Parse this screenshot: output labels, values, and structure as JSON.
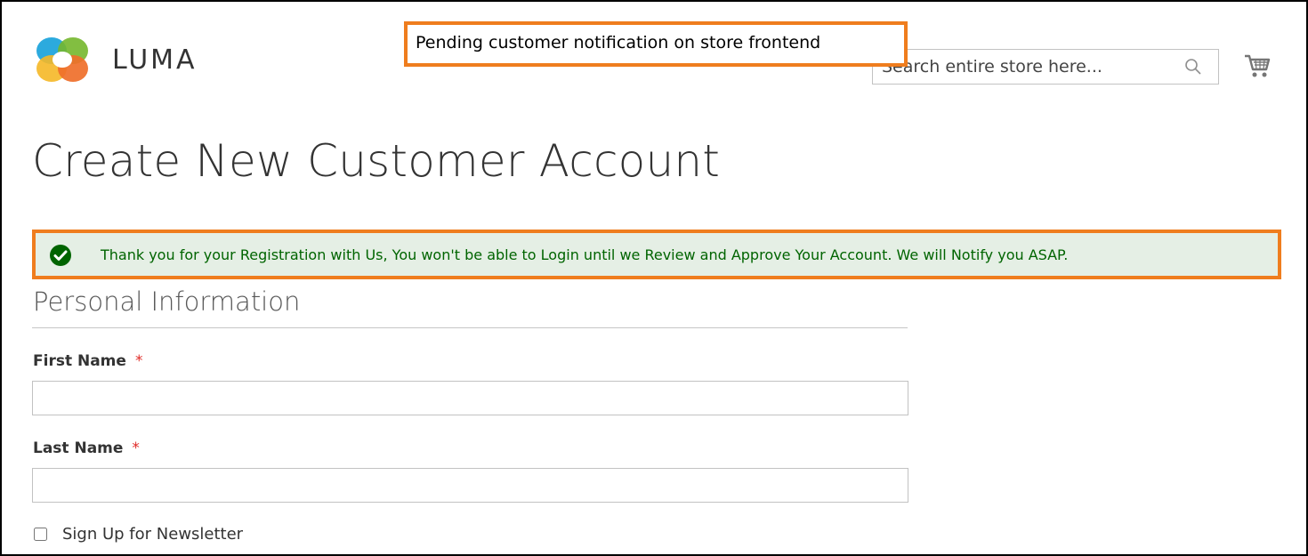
{
  "brand": {
    "name": "LUMA",
    "logo_icon": "luma-logo-icon"
  },
  "annotations": {
    "top_callout": "Pending customer notification on store frontend"
  },
  "header": {
    "search_placeholder": "Search entire store here...",
    "search_icon": "search-icon",
    "cart_icon": "cart-icon"
  },
  "page": {
    "title": "Create New Customer Account"
  },
  "message": {
    "type": "success",
    "icon": "check-circle-icon",
    "text": "Thank you for your Registration with Us, You won't be able to Login until we Review and Approve Your Account. We will Notify you ASAP."
  },
  "form": {
    "section_title": "Personal Information",
    "first_name_label": "First Name",
    "last_name_label": "Last Name",
    "required_mark": "*",
    "first_name_value": "",
    "last_name_value": "",
    "newsletter_label": "Sign Up for Newsletter",
    "newsletter_checked": false
  },
  "colors": {
    "callout_border": "#ef7d1e",
    "success_bg": "#e5efe5",
    "success_text": "#006400",
    "success_icon": "#006400",
    "required": "#e02b27"
  }
}
